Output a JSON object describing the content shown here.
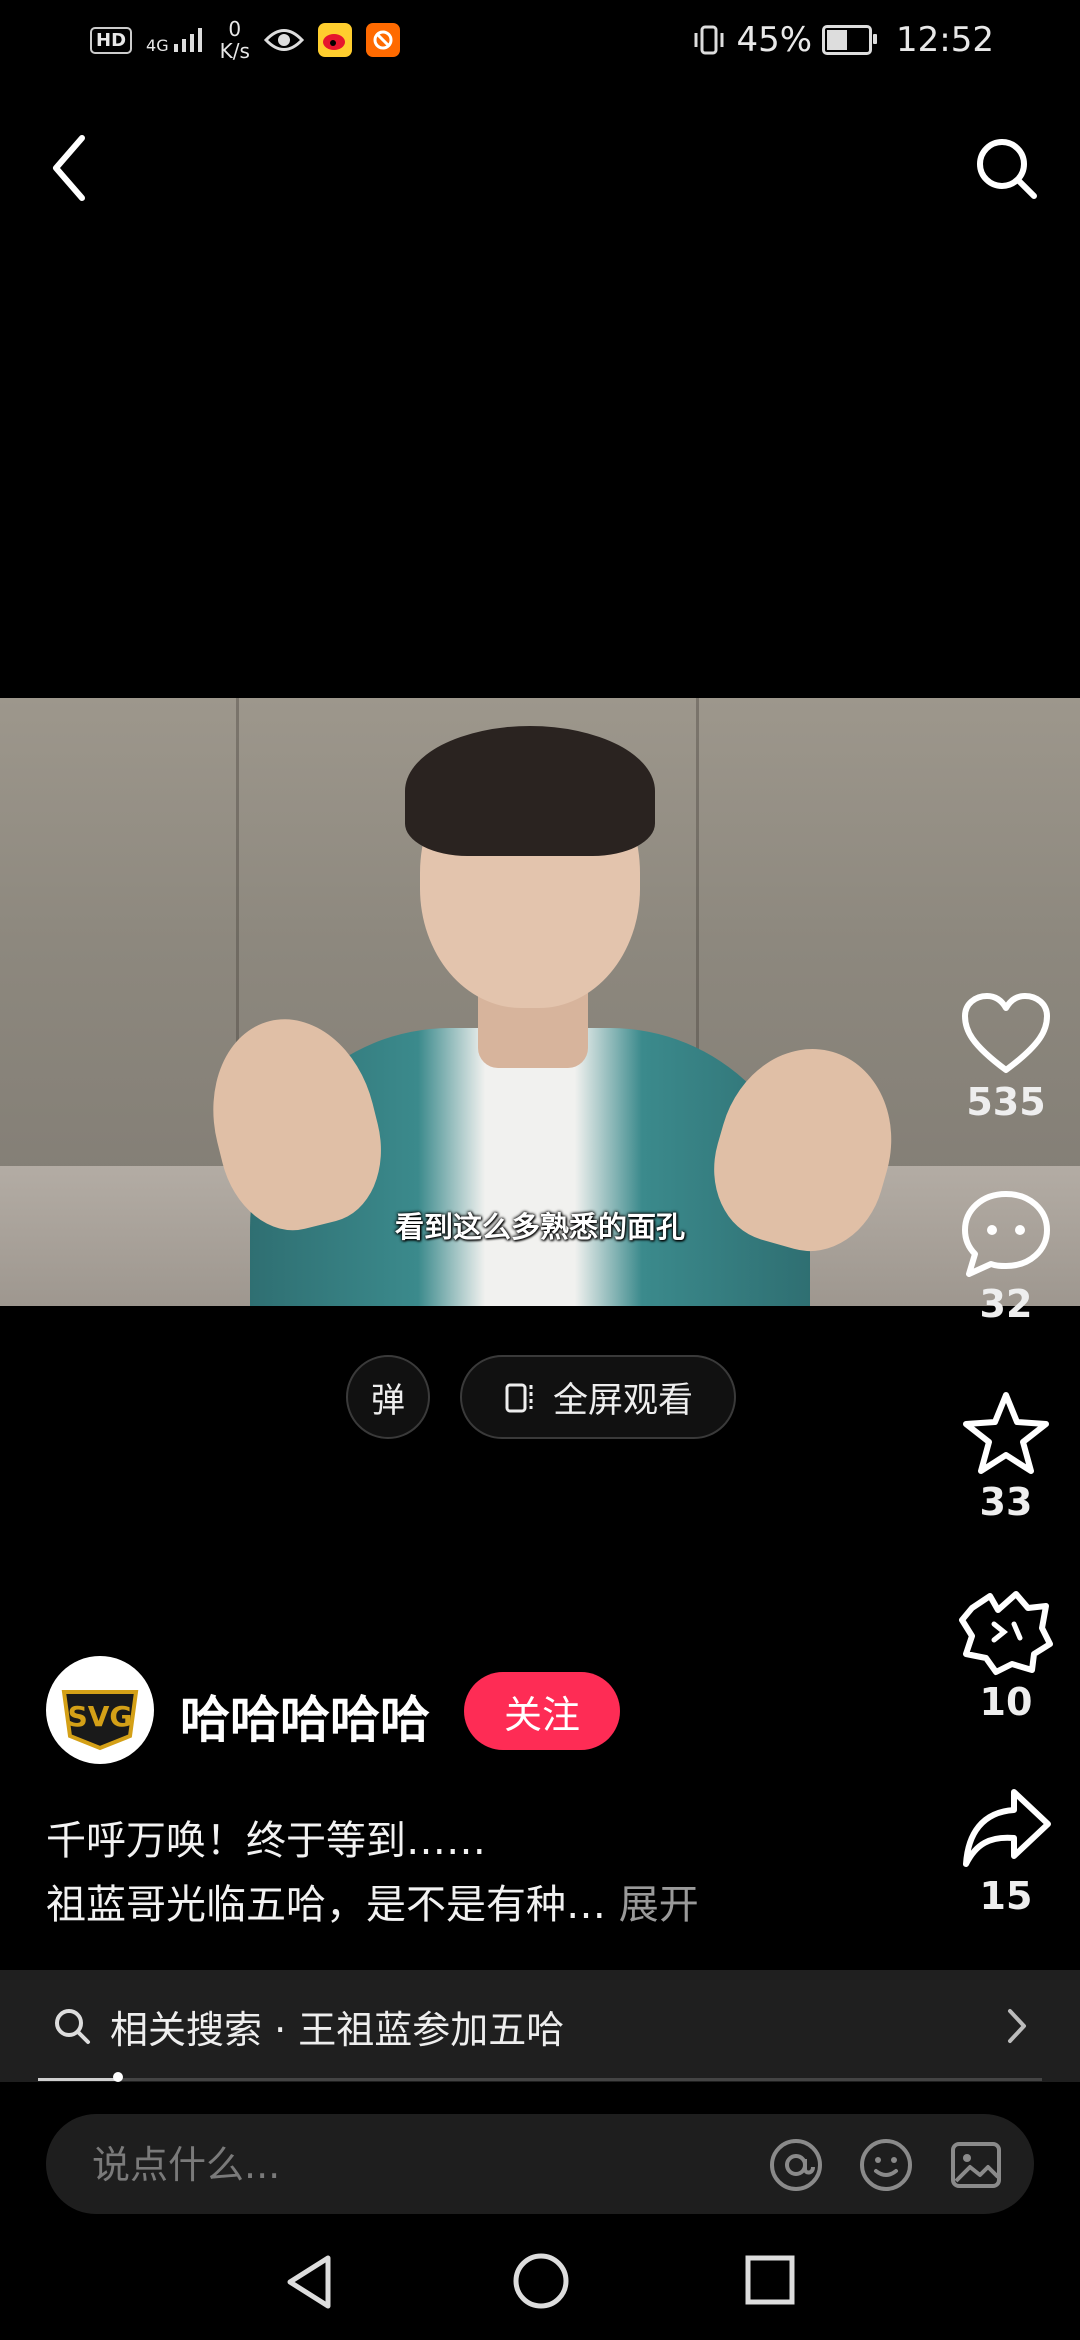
{
  "status_bar": {
    "network_hd": "HD",
    "network_type": "4G",
    "speed_value": "0",
    "speed_unit": "K/s",
    "battery": "45%",
    "time": "12:52"
  },
  "video": {
    "subtitle": "看到这么多熟悉的面孔"
  },
  "controls": {
    "danmu_label": "弹",
    "fullscreen_label": "全屏观看"
  },
  "actions": {
    "likes": "535",
    "comments": "32",
    "favorites": "33",
    "gifts": "10",
    "shares": "15"
  },
  "author": {
    "logo_text": "SVG",
    "name": "哈哈哈哈哈",
    "follow_label": "关注"
  },
  "description": {
    "line1": "千呼万唤！终于等到……",
    "line2": "祖蓝哥光临五哈，是不是有种…",
    "expand": "展开"
  },
  "related_search": {
    "text": "相关搜索 · 王祖蓝参加五哈"
  },
  "progress": 0.08,
  "comment_bar": {
    "placeholder": "说点什么..."
  },
  "colors": {
    "accent": "#fe2c55",
    "background": "#000000"
  }
}
